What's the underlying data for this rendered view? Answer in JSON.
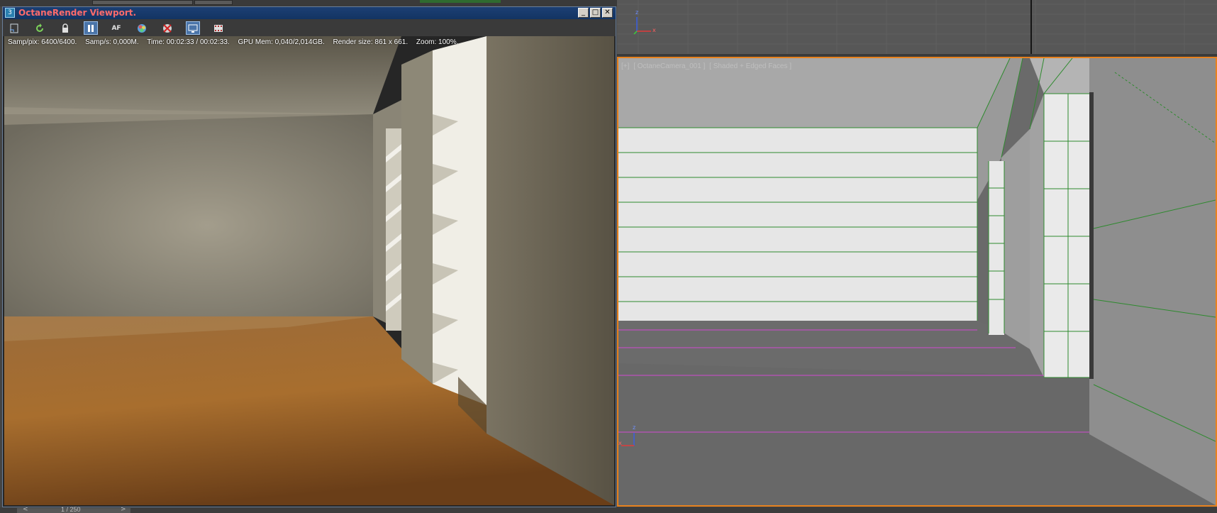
{
  "octane_window": {
    "title": "OctaneRender Viewport.",
    "title_icon_glyph": "3",
    "title_color": "#ff6b6b",
    "toolbar_icons": [
      "export-image-icon",
      "restart-render-icon",
      "lock-icon",
      "pause-icon",
      "autofocus-icon",
      "color-picker-icon",
      "region-render-icon",
      "display-mode-icon",
      "film-settings-icon"
    ],
    "toolbar_af_label": "AF",
    "stats": {
      "samples_per_pixel": "Samp/pix: 6400/6400.",
      "samples_per_second": "Samp/s: 0,000M.",
      "time": "Time: 00:02:33 / 00:02:33.",
      "gpu_mem": "GPU Mem: 0,040/2,014GB.",
      "render_size": "Render size: 861 x 661.",
      "zoom": "Zoom: 100%."
    }
  },
  "camera_viewport": {
    "label_plus": "[+]",
    "label_camera": "[ OctaneCamera_001 ]",
    "label_mode": "[ Shaded + Edged Faces ]",
    "active_border_color": "#e8821e"
  },
  "axis_labels": {
    "x": "x",
    "z": "z"
  },
  "timeline": {
    "prev": "<",
    "frame": "1 / 250",
    "next": ">"
  }
}
